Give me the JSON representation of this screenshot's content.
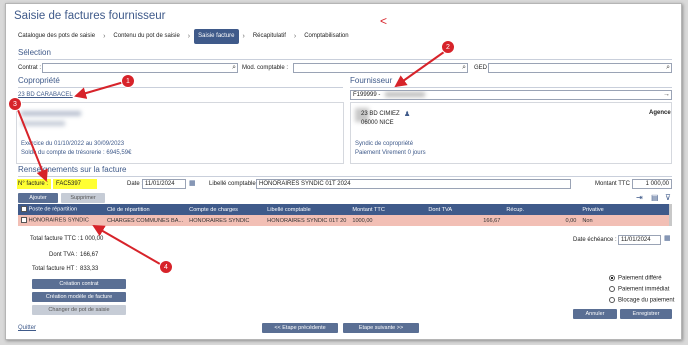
{
  "page": {
    "title": "Saisie de factures fournisseur",
    "back_icon": "<"
  },
  "steps": [
    {
      "label": "Catalogue des pots de saisie"
    },
    {
      "label": "Contenu du pot de saisie"
    },
    {
      "label": "Saisie facture"
    },
    {
      "label": "Récapitulatif"
    },
    {
      "label": "Comptabilisation"
    }
  ],
  "selection": {
    "title": "Sélection",
    "contrat_label": "Contrat :",
    "mod_label": "Mod. comptable :",
    "ged_label": "GED :"
  },
  "copropriete": {
    "title": "Copropriété",
    "link": "23 BD CARABACEL",
    "exercice": "Exercice du 01/10/2022 au 30/09/2023",
    "solde": "Solde du compte de trésorerie : 6945,59€"
  },
  "fournisseur": {
    "title": "Fournisseur",
    "value": "F199999 -",
    "address1": "23 BD CIMIEZ",
    "address2": "06000 NICE",
    "agency": "Agence",
    "line1": "Syndic de copropriété",
    "line2": "Paiement Virement 0 jours"
  },
  "renseignements": {
    "title": "Renseignements sur la facture",
    "facture_label": "N° facture :",
    "facture_value": "FAC5397",
    "date_label": "Date :",
    "date_value": "11/01/2024",
    "libelle_label": "Libellé comptable :",
    "libelle_value": "HONORAIRES SYNDIC 01T 2024",
    "montant_label": "Montant TTC :",
    "montant_value": "1 000,00"
  },
  "actions": {
    "ajouter": "Ajouter",
    "supprimer": "Supprimer"
  },
  "grid": {
    "headers": [
      "Poste de répartition",
      "Clé de répartition",
      "Compte de charges",
      "Libellé comptable",
      "Montant TTC",
      "Dont TVA",
      "Récup.",
      "Privative"
    ],
    "rows": [
      [
        "HONORAIRES SYNDIC",
        "CHARGES COMMUNES BA...",
        "HONORAIRES SYNDIC",
        "HONORAIRES SYNDIC 01T 20",
        "1000,00",
        "166,67",
        "0,00",
        "Non"
      ]
    ]
  },
  "totals": {
    "ttc_label": "Total facture TTC :",
    "ttc_value": "1 000,00",
    "tva_label": "Dont TVA :",
    "tva_value": "166,67",
    "ht_label": "Total facture HT :",
    "ht_value": "833,33"
  },
  "buttons": {
    "creation_contrat": "Création contrat",
    "creation_modele": "Création modèle de facture",
    "changer_pot": "Changer de pot de saisie",
    "annuler": "Annuler",
    "enregistrer": "Enregistrer",
    "precedente": "<< Etape précédente",
    "suivante": "Etape suivante >>",
    "quitter": "Quitter"
  },
  "echeance": {
    "label": "Date échéance :",
    "value": "11/01/2024"
  },
  "paiement": {
    "options": [
      "Paiement différé",
      "Paiement immédiat",
      "Blocage du paiement"
    ],
    "selected": 0
  },
  "callouts": [
    "1",
    "2",
    "3",
    "4"
  ],
  "colors": {
    "accent": "#3f5a8a",
    "row_highlight": "#f2bfb5",
    "annotation": "#d7232a",
    "highlight": "#ffff33"
  }
}
